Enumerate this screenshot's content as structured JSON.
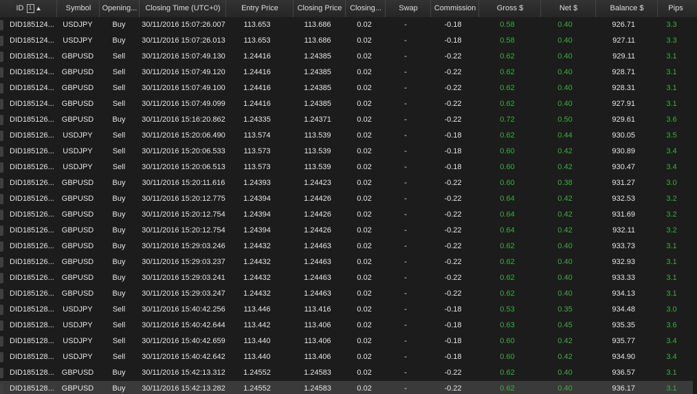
{
  "headers": {
    "id": "ID",
    "sort_index": "1",
    "symbol": "Symbol",
    "opening": "Opening...",
    "closing_time": "Closing Time (UTC+0)",
    "entry_price": "Entry Price",
    "closing_price": "Closing Price",
    "closing": "Closing...",
    "swap": "Swap",
    "commission": "Commission",
    "gross": "Gross $",
    "net": "Net $",
    "balance": "Balance $",
    "pips": "Pips"
  },
  "rows": [
    {
      "id": "DID185124...",
      "symbol": "USDJPY",
      "dir": "Buy",
      "time": "30/11/2016 15:07:26.007",
      "entry": "113.653",
      "close": "113.686",
      "qty": "0.02",
      "swap": "-",
      "comm": "-0.18",
      "gross": "0.58",
      "net": "0.40",
      "balance": "926.71",
      "pips": "3.3"
    },
    {
      "id": "DID185124...",
      "symbol": "USDJPY",
      "dir": "Buy",
      "time": "30/11/2016 15:07:26.013",
      "entry": "113.653",
      "close": "113.686",
      "qty": "0.02",
      "swap": "-",
      "comm": "-0.18",
      "gross": "0.58",
      "net": "0.40",
      "balance": "927.11",
      "pips": "3.3"
    },
    {
      "id": "DID185124...",
      "symbol": "GBPUSD",
      "dir": "Sell",
      "time": "30/11/2016 15:07:49.130",
      "entry": "1.24416",
      "close": "1.24385",
      "qty": "0.02",
      "swap": "-",
      "comm": "-0.22",
      "gross": "0.62",
      "net": "0.40",
      "balance": "929.11",
      "pips": "3.1"
    },
    {
      "id": "DID185124...",
      "symbol": "GBPUSD",
      "dir": "Sell",
      "time": "30/11/2016 15:07:49.120",
      "entry": "1.24416",
      "close": "1.24385",
      "qty": "0.02",
      "swap": "-",
      "comm": "-0.22",
      "gross": "0.62",
      "net": "0.40",
      "balance": "928.71",
      "pips": "3.1"
    },
    {
      "id": "DID185124...",
      "symbol": "GBPUSD",
      "dir": "Sell",
      "time": "30/11/2016 15:07:49.100",
      "entry": "1.24416",
      "close": "1.24385",
      "qty": "0.02",
      "swap": "-",
      "comm": "-0.22",
      "gross": "0.62",
      "net": "0.40",
      "balance": "928.31",
      "pips": "3.1"
    },
    {
      "id": "DID185124...",
      "symbol": "GBPUSD",
      "dir": "Sell",
      "time": "30/11/2016 15:07:49.099",
      "entry": "1.24416",
      "close": "1.24385",
      "qty": "0.02",
      "swap": "-",
      "comm": "-0.22",
      "gross": "0.62",
      "net": "0.40",
      "balance": "927.91",
      "pips": "3.1"
    },
    {
      "id": "DID185126...",
      "symbol": "GBPUSD",
      "dir": "Buy",
      "time": "30/11/2016 15:16:20.862",
      "entry": "1.24335",
      "close": "1.24371",
      "qty": "0.02",
      "swap": "-",
      "comm": "-0.22",
      "gross": "0.72",
      "net": "0.50",
      "balance": "929.61",
      "pips": "3.6"
    },
    {
      "id": "DID185126...",
      "symbol": "USDJPY",
      "dir": "Sell",
      "time": "30/11/2016 15:20:06.490",
      "entry": "113.574",
      "close": "113.539",
      "qty": "0.02",
      "swap": "-",
      "comm": "-0.18",
      "gross": "0.62",
      "net": "0.44",
      "balance": "930.05",
      "pips": "3.5"
    },
    {
      "id": "DID185126...",
      "symbol": "USDJPY",
      "dir": "Sell",
      "time": "30/11/2016 15:20:06.533",
      "entry": "113.573",
      "close": "113.539",
      "qty": "0.02",
      "swap": "-",
      "comm": "-0.18",
      "gross": "0.60",
      "net": "0.42",
      "balance": "930.89",
      "pips": "3.4"
    },
    {
      "id": "DID185126...",
      "symbol": "USDJPY",
      "dir": "Sell",
      "time": "30/11/2016 15:20:06.513",
      "entry": "113.573",
      "close": "113.539",
      "qty": "0.02",
      "swap": "-",
      "comm": "-0.18",
      "gross": "0.60",
      "net": "0.42",
      "balance": "930.47",
      "pips": "3.4"
    },
    {
      "id": "DID185126...",
      "symbol": "GBPUSD",
      "dir": "Buy",
      "time": "30/11/2016 15:20:11.616",
      "entry": "1.24393",
      "close": "1.24423",
      "qty": "0.02",
      "swap": "-",
      "comm": "-0.22",
      "gross": "0.60",
      "net": "0.38",
      "balance": "931.27",
      "pips": "3.0"
    },
    {
      "id": "DID185126...",
      "symbol": "GBPUSD",
      "dir": "Buy",
      "time": "30/11/2016 15:20:12.775",
      "entry": "1.24394",
      "close": "1.24426",
      "qty": "0.02",
      "swap": "-",
      "comm": "-0.22",
      "gross": "0.64",
      "net": "0.42",
      "balance": "932.53",
      "pips": "3.2"
    },
    {
      "id": "DID185126...",
      "symbol": "GBPUSD",
      "dir": "Buy",
      "time": "30/11/2016 15:20:12.754",
      "entry": "1.24394",
      "close": "1.24426",
      "qty": "0.02",
      "swap": "-",
      "comm": "-0.22",
      "gross": "0.64",
      "net": "0.42",
      "balance": "931.69",
      "pips": "3.2"
    },
    {
      "id": "DID185126...",
      "symbol": "GBPUSD",
      "dir": "Buy",
      "time": "30/11/2016 15:20:12.754",
      "entry": "1.24394",
      "close": "1.24426",
      "qty": "0.02",
      "swap": "-",
      "comm": "-0.22",
      "gross": "0.64",
      "net": "0.42",
      "balance": "932.11",
      "pips": "3.2"
    },
    {
      "id": "DID185126...",
      "symbol": "GBPUSD",
      "dir": "Buy",
      "time": "30/11/2016 15:29:03.246",
      "entry": "1.24432",
      "close": "1.24463",
      "qty": "0.02",
      "swap": "-",
      "comm": "-0.22",
      "gross": "0.62",
      "net": "0.40",
      "balance": "933.73",
      "pips": "3.1"
    },
    {
      "id": "DID185126...",
      "symbol": "GBPUSD",
      "dir": "Buy",
      "time": "30/11/2016 15:29:03.237",
      "entry": "1.24432",
      "close": "1.24463",
      "qty": "0.02",
      "swap": "-",
      "comm": "-0.22",
      "gross": "0.62",
      "net": "0.40",
      "balance": "932.93",
      "pips": "3.1"
    },
    {
      "id": "DID185126...",
      "symbol": "GBPUSD",
      "dir": "Buy",
      "time": "30/11/2016 15:29:03.241",
      "entry": "1.24432",
      "close": "1.24463",
      "qty": "0.02",
      "swap": "-",
      "comm": "-0.22",
      "gross": "0.62",
      "net": "0.40",
      "balance": "933.33",
      "pips": "3.1"
    },
    {
      "id": "DID185126...",
      "symbol": "GBPUSD",
      "dir": "Buy",
      "time": "30/11/2016 15:29:03.247",
      "entry": "1.24432",
      "close": "1.24463",
      "qty": "0.02",
      "swap": "-",
      "comm": "-0.22",
      "gross": "0.62",
      "net": "0.40",
      "balance": "934.13",
      "pips": "3.1"
    },
    {
      "id": "DID185128...",
      "symbol": "USDJPY",
      "dir": "Sell",
      "time": "30/11/2016 15:40:42.256",
      "entry": "113.446",
      "close": "113.416",
      "qty": "0.02",
      "swap": "-",
      "comm": "-0.18",
      "gross": "0.53",
      "net": "0.35",
      "balance": "934.48",
      "pips": "3.0"
    },
    {
      "id": "DID185128...",
      "symbol": "USDJPY",
      "dir": "Sell",
      "time": "30/11/2016 15:40:42.644",
      "entry": "113.442",
      "close": "113.406",
      "qty": "0.02",
      "swap": "-",
      "comm": "-0.18",
      "gross": "0.63",
      "net": "0.45",
      "balance": "935.35",
      "pips": "3.6"
    },
    {
      "id": "DID185128...",
      "symbol": "USDJPY",
      "dir": "Sell",
      "time": "30/11/2016 15:40:42.659",
      "entry": "113.440",
      "close": "113.406",
      "qty": "0.02",
      "swap": "-",
      "comm": "-0.18",
      "gross": "0.60",
      "net": "0.42",
      "balance": "935.77",
      "pips": "3.4"
    },
    {
      "id": "DID185128...",
      "symbol": "USDJPY",
      "dir": "Sell",
      "time": "30/11/2016 15:40:42.642",
      "entry": "113.440",
      "close": "113.406",
      "qty": "0.02",
      "swap": "-",
      "comm": "-0.18",
      "gross": "0.60",
      "net": "0.42",
      "balance": "934.90",
      "pips": "3.4"
    },
    {
      "id": "DID185128...",
      "symbol": "GBPUSD",
      "dir": "Buy",
      "time": "30/11/2016 15:42:13.312",
      "entry": "1.24552",
      "close": "1.24583",
      "qty": "0.02",
      "swap": "-",
      "comm": "-0.22",
      "gross": "0.62",
      "net": "0.40",
      "balance": "936.57",
      "pips": "3.1"
    },
    {
      "id": "DID185128...",
      "symbol": "GBPUSD",
      "dir": "Buy",
      "time": "30/11/2016 15:42:13.282",
      "entry": "1.24552",
      "close": "1.24583",
      "qty": "0.02",
      "swap": "-",
      "comm": "-0.22",
      "gross": "0.62",
      "net": "0.40",
      "balance": "936.17",
      "pips": "3.1"
    }
  ],
  "colors": {
    "profit_green": "#3fae3f",
    "header_bg": "#2c2c2c",
    "row_bg": "#1c1c1c"
  }
}
